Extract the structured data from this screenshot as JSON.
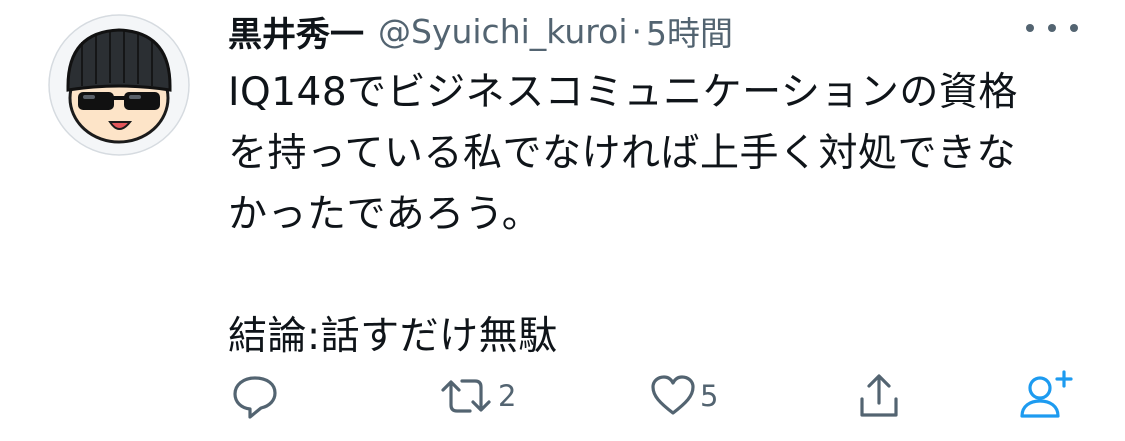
{
  "tweet": {
    "author_name": "黒井秀一",
    "handle": "@Syuichi_kuroi",
    "separator": "·",
    "time": "5時間",
    "text": "IQ148でビジネスコミュニケーションの資格\nを持っている私でなければ上手く対処できな\nかったであろう。\n\n結論:話すだけ無駄",
    "avatar_icon": "sunglasses-beanie-avatar-icon"
  },
  "actions": {
    "reply_icon": "reply-icon",
    "retweet_icon": "retweet-icon",
    "retweet_count": "2",
    "like_icon": "heart-icon",
    "like_count": "5",
    "share_icon": "share-icon",
    "follow_icon": "add-user-icon"
  },
  "colors": {
    "text_primary": "#0f1419",
    "text_secondary": "#536471",
    "accent_blue": "#1d9bf0",
    "icon_gray": "#536471"
  }
}
